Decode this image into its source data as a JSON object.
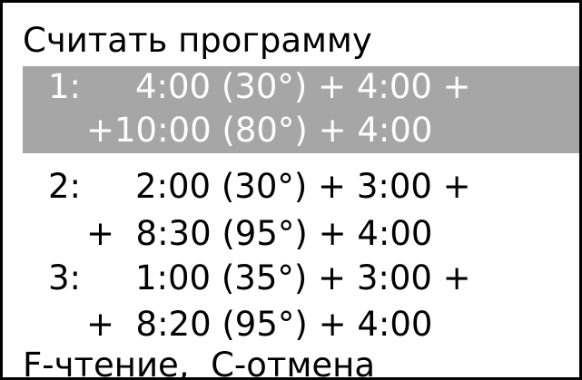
{
  "screen": {
    "title": "Считать программу",
    "footer": "F-чтение,  С-отмена",
    "colors": {
      "background": "#ffffff",
      "text": "#000000",
      "selection_background": "#a6a6a6",
      "selection_text": "#ffffff"
    }
  },
  "programs": [
    {
      "number": "1:",
      "line1": "4:00 (30°) + 4:00 +",
      "line2": "+10:00 (80°) + 4:00",
      "selected": true
    },
    {
      "number": "2:",
      "line1": "2:00 (30°) + 3:00 +",
      "line2": "+  8:30 (95°) + 4:00",
      "selected": false
    },
    {
      "number": "3:",
      "line1": "1:00 (35°) + 3:00 +",
      "line2": "+  8:20 (95°) + 4:00",
      "selected": false
    }
  ]
}
